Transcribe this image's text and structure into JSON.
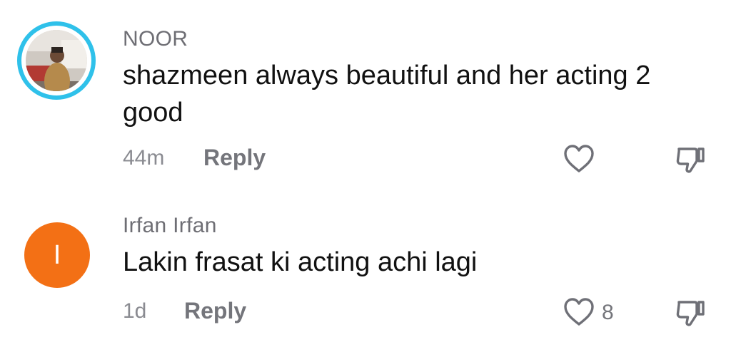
{
  "comments": [
    {
      "username": "NOOR",
      "text": "shazmeen always beautiful and her acting 2 good",
      "time": "44m",
      "reply_label": "Reply",
      "avatar": "photo-avatar",
      "like_count": ""
    },
    {
      "username": "Irfan Irfan",
      "text": "Lakin frasat ki acting achi lagi",
      "time": "1d",
      "reply_label": "Reply",
      "avatar_letter": "I",
      "avatar_color": "#f37015",
      "like_count": "8"
    }
  ],
  "icons": {
    "like": "heart-outline-icon",
    "dislike": "thumbs-down-icon"
  },
  "colors": {
    "story_ring": "#2fc1ea",
    "username": "#6e6e74",
    "meta": "#8a8b91"
  }
}
